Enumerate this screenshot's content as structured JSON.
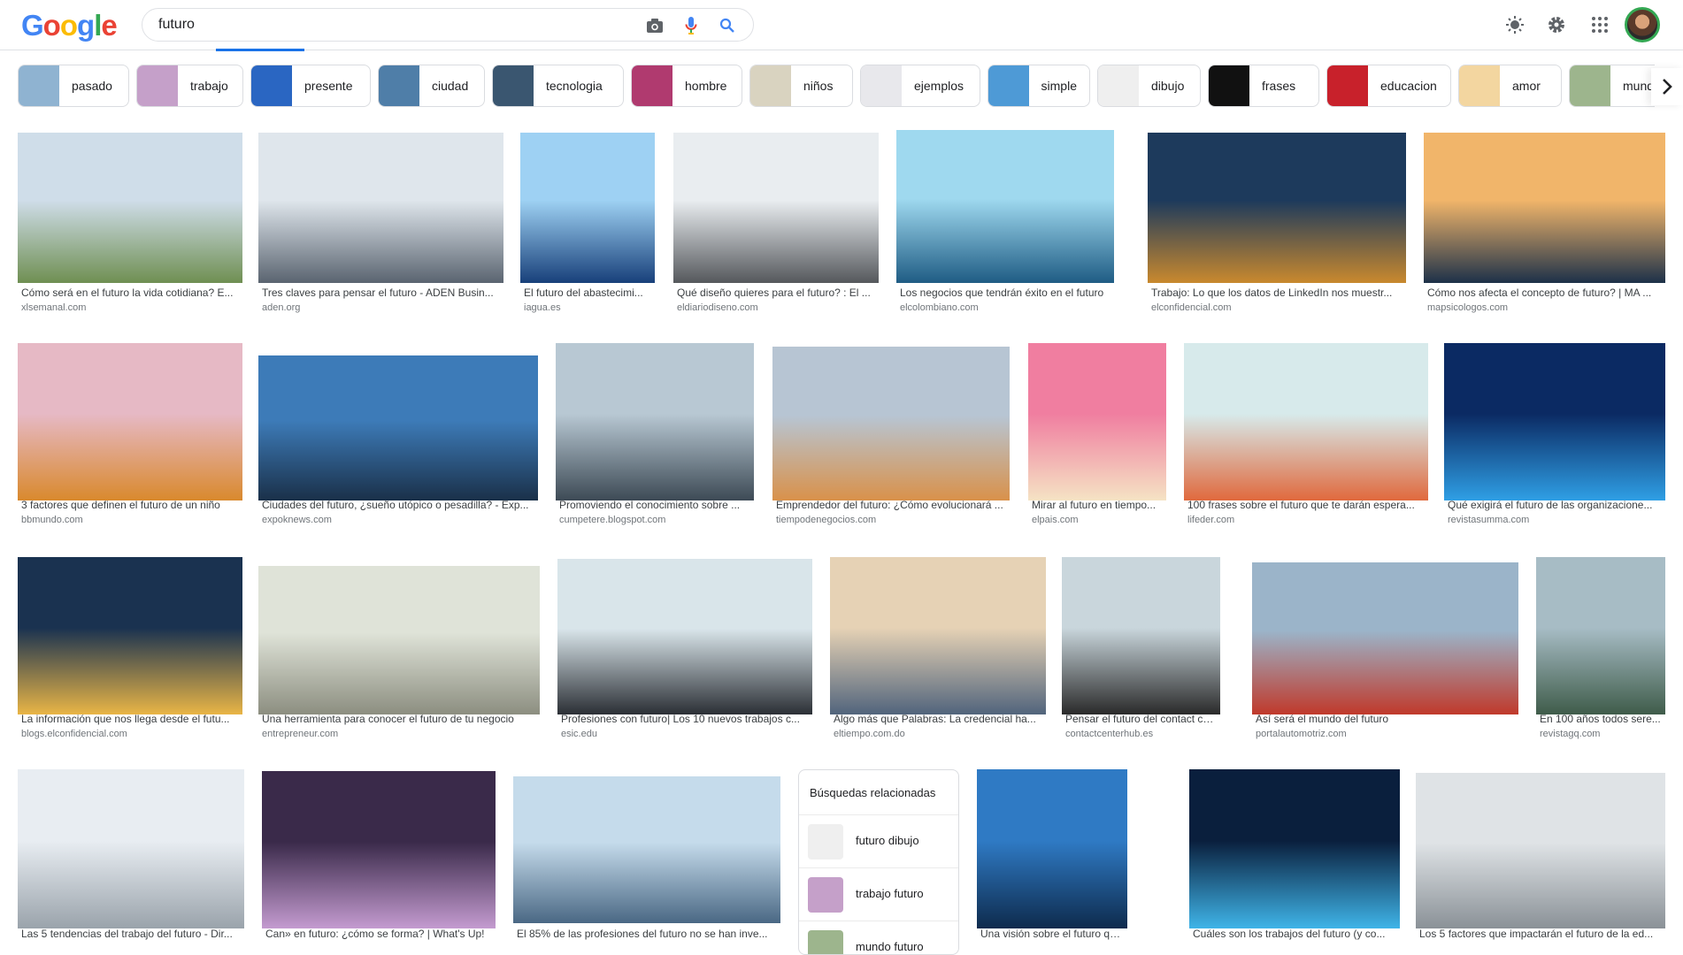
{
  "header": {
    "logo": [
      "G",
      "o",
      "o",
      "g",
      "l",
      "e"
    ],
    "search_value": "futuro",
    "icons": [
      "camera-icon",
      "mic-icon",
      "search-icon",
      "brightness-icon",
      "gear-icon",
      "apps-icon"
    ]
  },
  "chips": [
    {
      "label": "pasado",
      "color": "#8fb3d1"
    },
    {
      "label": "trabajo",
      "color": "#c5a0c9"
    },
    {
      "label": "presente",
      "color": "#2a66c2"
    },
    {
      "label": "ciudad",
      "color": "#4f7ea8"
    },
    {
      "label": "tecnologia",
      "color": "#3a5670"
    },
    {
      "label": "hombre",
      "color": "#b03a6f"
    },
    {
      "label": "niños",
      "color": "#d9d3c0"
    },
    {
      "label": "ejemplos",
      "color": "#e8e8ec"
    },
    {
      "label": "simple",
      "color": "#4e9ad6"
    },
    {
      "label": "dibujo",
      "color": "#efefef"
    },
    {
      "label": "frases",
      "color": "#111111"
    },
    {
      "label": "educacion",
      "color": "#c8212b"
    },
    {
      "label": "amor",
      "color": "#f3d6a0"
    },
    {
      "label": "mundo",
      "color": "#9db58d"
    }
  ],
  "results": [
    {
      "title": "Cómo será en el futuro la vida cotidiana? E...",
      "source": "xlsemanal.com",
      "c1": "#cfdde9",
      "c2": "#6f8f52"
    },
    {
      "title": "Tres claves para pensar el futuro - ADEN Busin...",
      "source": "aden.org",
      "c1": "#dfe6ec",
      "c2": "#5a6470"
    },
    {
      "title": "El futuro del abastecimi...",
      "source": "iagua.es",
      "c1": "#9ed1f3",
      "c2": "#18407a"
    },
    {
      "title": "Qué diseño quieres para el futuro? : El ...",
      "source": "eldiariodiseno.com",
      "c1": "#e9edf0",
      "c2": "#55585c"
    },
    {
      "title": "Los negocios que tendrán éxito en el futuro",
      "source": "elcolombiano.com",
      "c1": "#9fd9ef",
      "c2": "#1f5c84"
    },
    {
      "title": "Trabajo: Lo que los datos de LinkedIn nos muestr...",
      "source": "elconfidencial.com",
      "c1": "#1d3a5c",
      "c2": "#c9892e"
    },
    {
      "title": "Cómo nos afecta el concepto de futuro? | MA ...",
      "source": "mapsicologos.com",
      "c1": "#f1b56a",
      "c2": "#1d3149"
    },
    {
      "title": "3 factores que definen el futuro de un niño",
      "source": "bbmundo.com",
      "c1": "#e6b9c5",
      "c2": "#d9892d"
    },
    {
      "title": "Ciudades del futuro, ¿sueño utópico o pesadilla? - Exp...",
      "source": "expoknews.com",
      "c1": "#3d7bb8",
      "c2": "#1a3049"
    },
    {
      "title": "Promoviendo el conocimiento sobre ...",
      "source": "cumpetere.blogspot.com",
      "c1": "#b8c8d3",
      "c2": "#3d4a55"
    },
    {
      "title": "Emprendedor del futuro: ¿Cómo evolucionará ...",
      "source": "tiempodenegocios.com",
      "c1": "#b7c5d3",
      "c2": "#d9914a"
    },
    {
      "title": "Mirar al futuro en tiempo...",
      "source": "elpais.com",
      "c1": "#f07ea0",
      "c2": "#f5e3c4"
    },
    {
      "title": "100 frases sobre el futuro que te darán espera...",
      "source": "lifeder.com",
      "c1": "#d7eaeb",
      "c2": "#e0693d"
    },
    {
      "title": "Qué exigirá el futuro de las organizacione...",
      "source": "revistasumma.com",
      "c1": "#0b2a63",
      "c2": "#2f9fe5"
    },
    {
      "title": "La información que nos llega desde el futu...",
      "source": "blogs.elconfidencial.com",
      "c1": "#1a3250",
      "c2": "#e9b546"
    },
    {
      "title": "Una herramienta para conocer el futuro de tu negocio",
      "source": "entrepreneur.com",
      "c1": "#dfe3d8",
      "c2": "#8c8e80"
    },
    {
      "title": "Profesiones con futuro| Los 10 nuevos trabajos c...",
      "source": "esic.edu",
      "c1": "#d9e5ea",
      "c2": "#2b2f35"
    },
    {
      "title": "Algo más que Palabras: La credencial ha...",
      "source": "eltiempo.com.do",
      "c1": "#e6d2b5",
      "c2": "#51647c"
    },
    {
      "title": "Pensar el futuro del contact cen...",
      "source": "contactcenterhub.es",
      "c1": "#c9d6dc",
      "c2": "#2a2a2a"
    },
    {
      "title": "Así será el mundo del futuro",
      "source": "portalautomotriz.com",
      "c1": "#9bb4c9",
      "c2": "#c0392b"
    },
    {
      "title": "En 100 años todos sere...",
      "source": "revistagq.com",
      "c1": "#a7bcc5",
      "c2": "#3f5c4a"
    },
    {
      "title": "Las 5 tendencias del trabajo del futuro - Dir...",
      "source": "",
      "c1": "#e8edf2",
      "c2": "#9aa3ab"
    },
    {
      "title": "Can» en futuro: ¿cómo se forma? | What's Up!",
      "source": "",
      "c1": "#3a2a4a",
      "c2": "#c49bd0"
    },
    {
      "title": "El 85% de las profesiones del futuro no se han inve...",
      "source": "",
      "c1": "#c5dbeb",
      "c2": "#4a6884"
    },
    {
      "title": "Una visión sobre el futuro que nos es...",
      "source": "",
      "c1": "#2f7ac4",
      "c2": "#0e2b4d"
    },
    {
      "title": "Cuáles son los trabajos del futuro (y co...",
      "source": "",
      "c1": "#0a1f3d",
      "c2": "#3fb4e8"
    },
    {
      "title": "Los 5 factores que impactarán el futuro de la ed...",
      "source": "",
      "c1": "#dfe3e6",
      "c2": "#8a9197"
    }
  ],
  "related": {
    "heading": "Búsquedas relacionadas",
    "items": [
      {
        "label": "futuro dibujo",
        "color": "#efefef"
      },
      {
        "label": "trabajo futuro",
        "color": "#c5a0c9"
      },
      {
        "label": "mundo futuro",
        "color": "#9db58d"
      }
    ]
  }
}
